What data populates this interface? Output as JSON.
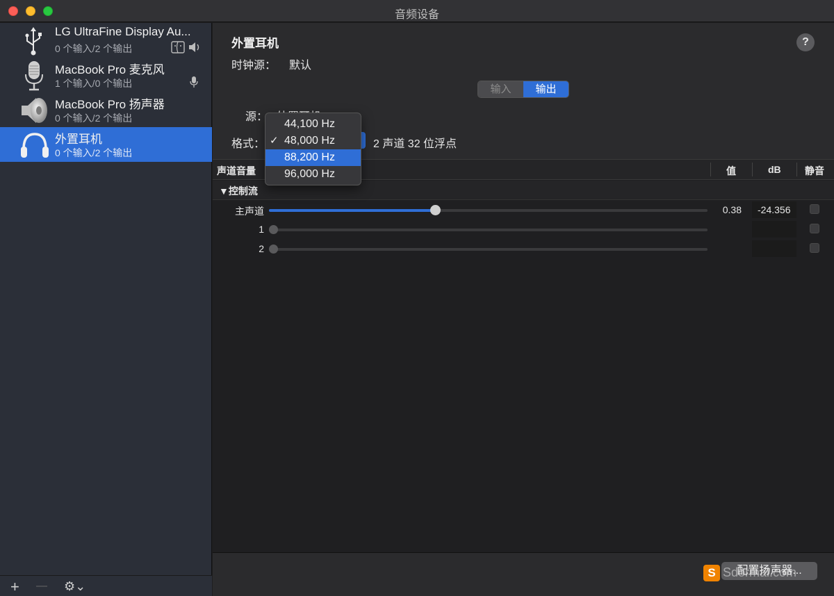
{
  "window": {
    "title": "音频设备"
  },
  "devices": [
    {
      "name": "LG UltraFine Display Au...",
      "sub": "0 个输入/2 个输出",
      "icon": "usb-icon",
      "badges": [
        "finder-icon",
        "speaker-volume-icon"
      ]
    },
    {
      "name": "MacBook Pro 麦克风",
      "sub": "1 个输入/0 个输出",
      "icon": "microphone-icon",
      "badges": [
        "small-microphone-icon"
      ]
    },
    {
      "name": "MacBook Pro 扬声器",
      "sub": "0 个输入/2 个输出",
      "icon": "speaker-icon",
      "badges": []
    },
    {
      "name": "外置耳机",
      "sub": "0 个输入/2 个输出",
      "icon": "headphones-icon",
      "badges": [],
      "selected": true
    }
  ],
  "sidebar_toolbar": {
    "add": "+",
    "remove": "—",
    "gear": "⚙︎⌄"
  },
  "detail": {
    "title": "外置耳机",
    "clock_label": "时钟源：",
    "clock_value": "默认",
    "help": "?",
    "tabs": [
      {
        "label": "输入",
        "active": false
      },
      {
        "label": "输出",
        "active": true
      }
    ],
    "source_label": "源：",
    "source_value": "外置耳机",
    "format_label": "格式：",
    "format_value": "2 声道 32 位浮点"
  },
  "format_menu": {
    "items": [
      "44,100 Hz",
      "48,000 Hz",
      "88,200 Hz",
      "96,000 Hz"
    ],
    "checked": "48,000 Hz",
    "highlighted": "88,200 Hz"
  },
  "table": {
    "headers": {
      "channel_volume": "声道音量",
      "value": "值",
      "db": "dB",
      "mute": "静音"
    },
    "group": "▼控制流",
    "channels": [
      {
        "label": "主声道",
        "value": "0.38",
        "db": "-24.356",
        "level": 0.38,
        "active": true,
        "muted": false
      },
      {
        "label": "1",
        "value": "",
        "db": "",
        "level": 0,
        "active": false,
        "muted": false
      },
      {
        "label": "2",
        "value": "",
        "db": "",
        "level": 0,
        "active": false,
        "muted": false
      }
    ]
  },
  "footer": {
    "configure_button": "配置扬声器..."
  },
  "watermark": {
    "logo": "S",
    "text": "Sdormal.com"
  },
  "colors": {
    "accent": "#2f6ed6",
    "sidebar": "#2b2f38",
    "main": "#1f1f21"
  }
}
